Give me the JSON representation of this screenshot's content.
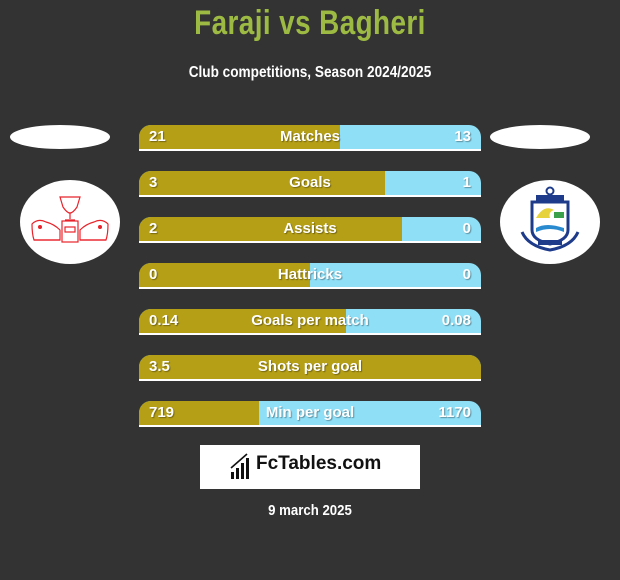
{
  "header": {
    "title": "Faraji vs Bagheri",
    "subtitle": "Club competitions, Season 2024/2025"
  },
  "players": {
    "left": {
      "name": "Faraji",
      "club_logo": "red-trophy-lions-crest"
    },
    "right": {
      "name": "Bagheri",
      "club_logo": "blue-anchor-crest"
    }
  },
  "colors": {
    "left": "#b59f17",
    "right": "#8fdff7",
    "title": "#9dba43",
    "background": "#333333"
  },
  "stats": [
    {
      "label": "Matches",
      "left": "21",
      "right": "13",
      "left_share": 0.588
    },
    {
      "label": "Goals",
      "left": "3",
      "right": "1",
      "left_share": 0.72
    },
    {
      "label": "Assists",
      "left": "2",
      "right": "0",
      "left_share": 0.77
    },
    {
      "label": "Hattricks",
      "left": "0",
      "right": "0",
      "left_share": 0.5
    },
    {
      "label": "Goals per match",
      "left": "0.14",
      "right": "0.08",
      "left_share": 0.605
    },
    {
      "label": "Shots per goal",
      "left": "3.5",
      "right": "",
      "left_share": 1.0
    },
    {
      "label": "Min per goal",
      "left": "719",
      "right": "1170",
      "left_share": 0.35
    }
  ],
  "brand": {
    "name": "FcTables.com",
    "icon": "bar-chart-icon"
  },
  "footer": {
    "date": "9 march 2025"
  }
}
